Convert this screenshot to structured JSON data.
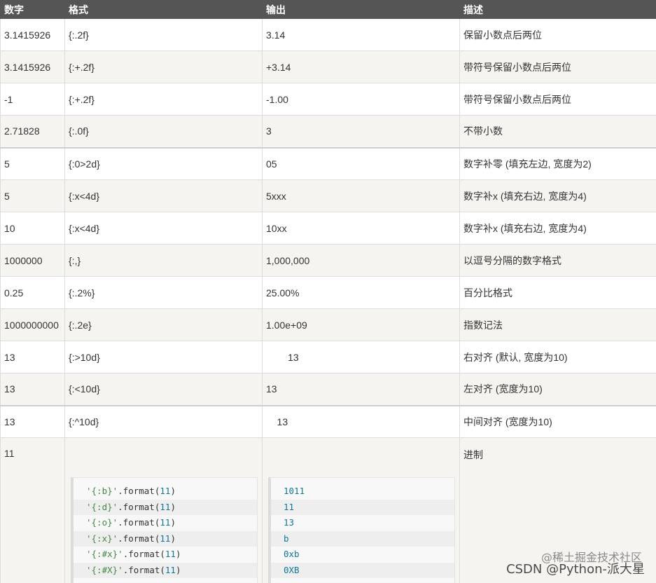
{
  "table": {
    "headers": [
      "数字",
      "格式",
      "输出",
      "描述"
    ],
    "rows": [
      {
        "number": "3.1415926",
        "format": "{:.2f}",
        "output": "3.14",
        "description": "保留小数点后两位"
      },
      {
        "number": "3.1415926",
        "format": "{:+.2f}",
        "output": "+3.14",
        "description": "带符号保留小数点后两位"
      },
      {
        "number": "-1",
        "format": "{:+.2f}",
        "output": "-1.00",
        "description": "带符号保留小数点后两位"
      },
      {
        "number": "2.71828",
        "format": "{:.0f}",
        "output": "3",
        "description": "不带小数"
      },
      {
        "number": "5",
        "format": "{:0>2d}",
        "output": "05",
        "description": "数字补零 (填充左边, 宽度为2)"
      },
      {
        "number": "5",
        "format": "{:x<4d}",
        "output": "5xxx",
        "description": "数字补x (填充右边, 宽度为4)"
      },
      {
        "number": "10",
        "format": "{:x<4d}",
        "output": "10xx",
        "description": "数字补x (填充右边, 宽度为4)"
      },
      {
        "number": "1000000",
        "format": "{:,}",
        "output": "1,000,000",
        "description": "以逗号分隔的数字格式"
      },
      {
        "number": "0.25",
        "format": "{:.2%}",
        "output": "25.00%",
        "description": "百分比格式"
      },
      {
        "number": "1000000000",
        "format": "{:.2e}",
        "output": "1.00e+09",
        "description": "指数记法"
      },
      {
        "number": "13",
        "format": "{:>10d}",
        "output": "        13",
        "description": "右对齐 (默认, 宽度为10)"
      },
      {
        "number": "13",
        "format": "{:<10d}",
        "output": "13",
        "description": "左对齐 (宽度为10)"
      },
      {
        "number": "13",
        "format": "{:^10d}",
        "output": "    13",
        "description": "中间对齐 (宽度为10)"
      }
    ],
    "base_row": {
      "number": "11",
      "description": "进制",
      "code_lines": [
        {
          "str": "'{:b}'",
          "fn": ".format(",
          "num": "11",
          "close": ")"
        },
        {
          "str": "'{:d}'",
          "fn": ".format(",
          "num": "11",
          "close": ")"
        },
        {
          "str": "'{:o}'",
          "fn": ".format(",
          "num": "11",
          "close": ")"
        },
        {
          "str": "'{:x}'",
          "fn": ".format(",
          "num": "11",
          "close": ")"
        },
        {
          "str": "'{:#x}'",
          "fn": ".format(",
          "num": "11",
          "close": ")"
        },
        {
          "str": "'{:#X}'",
          "fn": ".format(",
          "num": "11",
          "close": ")"
        }
      ],
      "output_lines": [
        "1011",
        "11",
        "13",
        "b",
        "0xb",
        "0XB"
      ]
    }
  },
  "watermark": {
    "line1": "@稀土掘金技术社区",
    "line2": "CSDN @Python-派大星"
  },
  "colors": {
    "header_bg": "#555555",
    "row_alt_bg": "#f6f4f0",
    "code_string": "#448844",
    "code_number": "#117799"
  }
}
